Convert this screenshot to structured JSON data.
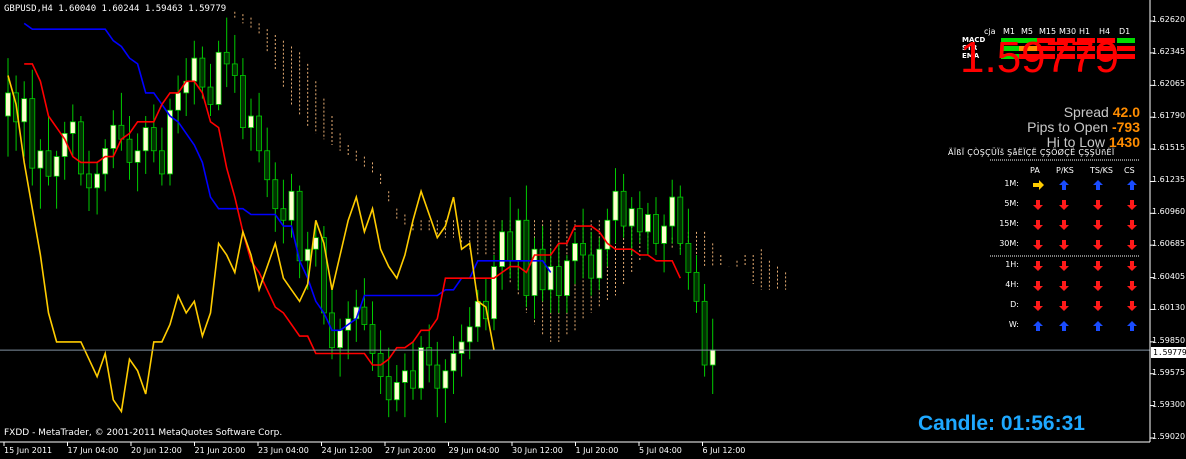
{
  "header": {
    "symbol": "GBPUSD,H4",
    "quote": "1.60040 1.60244 1.59463 1.59779"
  },
  "copyright": "FXDD - MetaTrader, © 2001-2011 MetaQuotes Software Corp.",
  "dashboard": {
    "corner_label": "cja",
    "timeframes": [
      "M1",
      "M5",
      "M15",
      "M30",
      "H1",
      "H4",
      "D1"
    ],
    "indicators": [
      {
        "name": "MACD",
        "colors": [
          "#00dd00",
          "#00dd00",
          "#ff0000",
          "#ff0000",
          "#ff0000",
          "#ff0000",
          "#00dd00"
        ]
      },
      {
        "name": "STR",
        "colors": [
          "#00dd00",
          "#ff8c00",
          "#ff0000",
          "#ff0000",
          "#ff0000",
          "#ff0000",
          "#ff0000"
        ]
      },
      {
        "name": "EMA",
        "colors": [
          "#00dd00",
          "#ff0000",
          "#ff0000",
          "#ff0000",
          "#ff0000",
          "#ff0000",
          "#ff0000"
        ]
      }
    ],
    "price": "1.59779",
    "spread_label": "Spread",
    "spread_value": "42.0",
    "pips_label": "Pips to Open",
    "pips_value": "-793",
    "hilo_label": "Hi to Low",
    "hilo_value": "1430",
    "matrix_title": "ÄÏßÏ ÇÒŞÇÜÏš ŞåËÏÇË ÇŞÖØÇË ÇŞŞÜñËÏ",
    "matrix_columns": [
      "PA",
      "P/KS",
      "TS/KS",
      "CS"
    ],
    "matrix_rows": [
      {
        "label": "1M:",
        "arrows": [
          "right",
          "up",
          "up",
          "up"
        ]
      },
      {
        "label": "5M:",
        "arrows": [
          "down",
          "down",
          "down",
          "down"
        ]
      },
      {
        "label": "15M:",
        "arrows": [
          "down",
          "down",
          "down",
          "down"
        ]
      },
      {
        "label": "30M:",
        "arrows": [
          "down",
          "down",
          "down",
          "down"
        ]
      },
      {
        "label": "1H:",
        "arrows": [
          "down",
          "down",
          "down",
          "down"
        ]
      },
      {
        "label": "4H:",
        "arrows": [
          "down",
          "down",
          "down",
          "down"
        ]
      },
      {
        "label": "D:",
        "arrows": [
          "down",
          "down",
          "down",
          "down"
        ]
      },
      {
        "label": "W:",
        "arrows": [
          "up",
          "up",
          "up",
          "up"
        ]
      }
    ],
    "candle_label": "Candle:",
    "candle_time": "01:56:31"
  },
  "colors": {
    "up_arrow": "#1a4cff",
    "down_arrow": "#ff1a1a",
    "right_arrow": "#ffcc00",
    "tenkan": "#ff0000",
    "kijun": "#0000ff",
    "chikou": "#ffcc00",
    "candle_up": "#ffffd0",
    "candle_down": "#003300",
    "wick": "#00cc00",
    "cloud": "#ffc080"
  },
  "chart_data": {
    "type": "candlestick",
    "symbol": "GBPUSD",
    "timeframe": "H4",
    "current_price": "1.59779",
    "ylim": [
      1.5902,
      1.6275
    ],
    "y_ticks": [
      "1.62620",
      "1.62345",
      "1.62065",
      "1.61790",
      "1.61515",
      "1.61235",
      "1.60960",
      "1.60685",
      "1.60405",
      "1.60130",
      "1.59850",
      "1.59575",
      "1.59300",
      "1.59020"
    ],
    "x_ticks": [
      "15 Jun 2011",
      "17 Jun 04:00",
      "20 Jun 12:00",
      "21 Jun 20:00",
      "23 Jun 04:00",
      "24 Jun 12:00",
      "27 Jun 20:00",
      "29 Jun 04:00",
      "30 Jun 12:00",
      "1 Jul 20:00",
      "5 Jul 04:00",
      "6 Jul 12:00"
    ],
    "candles": [
      [
        1.618,
        1.623,
        1.6145,
        1.62
      ],
      [
        1.62,
        1.6215,
        1.615,
        1.6175
      ],
      [
        1.6175,
        1.621,
        1.6145,
        1.6195
      ],
      [
        1.6195,
        1.622,
        1.612,
        1.6135
      ],
      [
        1.6135,
        1.616,
        1.61,
        1.615
      ],
      [
        1.615,
        1.618,
        1.612,
        1.6128
      ],
      [
        1.6128,
        1.615,
        1.61,
        1.6145
      ],
      [
        1.6145,
        1.6175,
        1.6125,
        1.6165
      ],
      [
        1.6165,
        1.619,
        1.6145,
        1.6175
      ],
      [
        1.6175,
        1.618,
        1.612,
        1.613
      ],
      [
        1.613,
        1.615,
        1.6098,
        1.6118
      ],
      [
        1.6118,
        1.614,
        1.6095,
        1.613
      ],
      [
        1.613,
        1.616,
        1.6115,
        1.6152
      ],
      [
        1.6152,
        1.6185,
        1.6135,
        1.6172
      ],
      [
        1.6172,
        1.62,
        1.615,
        1.616
      ],
      [
        1.616,
        1.618,
        1.6125,
        1.614
      ],
      [
        1.614,
        1.6165,
        1.6115,
        1.615
      ],
      [
        1.615,
        1.618,
        1.613,
        1.617
      ],
      [
        1.617,
        1.619,
        1.614,
        1.615
      ],
      [
        1.615,
        1.617,
        1.612,
        1.613
      ],
      [
        1.613,
        1.6195,
        1.612,
        1.6185
      ],
      [
        1.6185,
        1.6215,
        1.6165,
        1.62
      ],
      [
        1.62,
        1.623,
        1.618,
        1.621
      ],
      [
        1.621,
        1.6245,
        1.619,
        1.623
      ],
      [
        1.623,
        1.624,
        1.6195,
        1.6205
      ],
      [
        1.6205,
        1.6225,
        1.618,
        1.619
      ],
      [
        1.619,
        1.6245,
        1.6185,
        1.6235
      ],
      [
        1.6235,
        1.6265,
        1.6205,
        1.6225
      ],
      [
        1.6225,
        1.625,
        1.62,
        1.6215
      ],
      [
        1.6215,
        1.623,
        1.616,
        1.617
      ],
      [
        1.617,
        1.6195,
        1.615,
        1.618
      ],
      [
        1.618,
        1.62,
        1.614,
        1.615
      ],
      [
        1.615,
        1.617,
        1.611,
        1.6125
      ],
      [
        1.6125,
        1.614,
        1.608,
        1.61
      ],
      [
        1.61,
        1.6125,
        1.607,
        1.609
      ],
      [
        1.609,
        1.613,
        1.6075,
        1.6115
      ],
      [
        1.6115,
        1.612,
        1.604,
        1.6055
      ],
      [
        1.6055,
        1.608,
        1.603,
        1.6065
      ],
      [
        1.6065,
        1.609,
        1.605,
        1.6075
      ],
      [
        1.6075,
        1.6085,
        1.6,
        1.601
      ],
      [
        1.601,
        1.603,
        1.597,
        1.598
      ],
      [
        1.598,
        1.6005,
        1.5955,
        1.5995
      ],
      [
        1.5995,
        1.602,
        1.597,
        1.6005
      ],
      [
        1.6005,
        1.603,
        1.5985,
        1.6015
      ],
      [
        1.6015,
        1.604,
        1.5995,
        1.6
      ],
      [
        1.6,
        1.602,
        1.596,
        1.5975
      ],
      [
        1.5975,
        1.5995,
        1.594,
        1.5955
      ],
      [
        1.5955,
        1.598,
        1.592,
        1.5935
      ],
      [
        1.5935,
        1.5965,
        1.5925,
        1.595
      ],
      [
        1.595,
        1.5975,
        1.592,
        1.596
      ],
      [
        1.596,
        1.5985,
        1.5935,
        1.5945
      ],
      [
        1.5945,
        1.599,
        1.5935,
        1.598
      ],
      [
        1.598,
        1.6,
        1.595,
        1.5965
      ],
      [
        1.5965,
        1.5985,
        1.592,
        1.5945
      ],
      [
        1.5945,
        1.597,
        1.5915,
        1.596
      ],
      [
        1.596,
        1.599,
        1.594,
        1.5975
      ],
      [
        1.5975,
        1.6,
        1.5955,
        1.5985
      ],
      [
        1.5985,
        1.6015,
        1.597,
        1.5998
      ],
      [
        1.5998,
        1.603,
        1.5985,
        1.602
      ],
      [
        1.602,
        1.604,
        1.5995,
        1.6005
      ],
      [
        1.6005,
        1.606,
        1.5995,
        1.605
      ],
      [
        1.605,
        1.609,
        1.603,
        1.608
      ],
      [
        1.608,
        1.611,
        1.604,
        1.6055
      ],
      [
        1.6055,
        1.61,
        1.603,
        1.609
      ],
      [
        1.609,
        1.612,
        1.6015,
        1.6025
      ],
      [
        1.6025,
        1.6075,
        1.6005,
        1.6065
      ],
      [
        1.6065,
        1.6085,
        1.602,
        1.603
      ],
      [
        1.603,
        1.6065,
        1.601,
        1.605
      ],
      [
        1.605,
        1.607,
        1.601,
        1.6025
      ],
      [
        1.6025,
        1.606,
        1.601,
        1.6055
      ],
      [
        1.6055,
        1.608,
        1.6035,
        1.607
      ],
      [
        1.607,
        1.61,
        1.604,
        1.606
      ],
      [
        1.606,
        1.608,
        1.6025,
        1.604
      ],
      [
        1.604,
        1.6075,
        1.603,
        1.6065
      ],
      [
        1.6065,
        1.61,
        1.605,
        1.609
      ],
      [
        1.609,
        1.6135,
        1.607,
        1.6115
      ],
      [
        1.6115,
        1.613,
        1.6075,
        1.6085
      ],
      [
        1.6085,
        1.611,
        1.606,
        1.61
      ],
      [
        1.61,
        1.6115,
        1.607,
        1.608
      ],
      [
        1.608,
        1.6105,
        1.606,
        1.6095
      ],
      [
        1.6095,
        1.611,
        1.606,
        1.607
      ],
      [
        1.607,
        1.6095,
        1.6045,
        1.6085
      ],
      [
        1.6085,
        1.6125,
        1.607,
        1.611
      ],
      [
        1.611,
        1.612,
        1.606,
        1.607
      ],
      [
        1.607,
        1.61,
        1.603,
        1.6045
      ],
      [
        1.6045,
        1.606,
        1.601,
        1.602
      ],
      [
        1.602,
        1.6035,
        1.5955,
        1.5965
      ],
      [
        1.5965,
        1.6005,
        1.594,
        1.5978
      ]
    ],
    "tenkan": [
      1.6225,
      1.6225,
      1.621,
      1.618,
      1.617,
      1.616,
      1.6145,
      1.614,
      1.614,
      1.614,
      1.6145,
      1.6145,
      1.616,
      1.6165,
      1.6175,
      1.6175,
      1.6175,
      1.619,
      1.62,
      1.62,
      1.621,
      1.621,
      1.62,
      1.6175,
      1.617,
      1.6135,
      1.611,
      1.608,
      1.6055,
      1.6045,
      1.603,
      1.6015,
      1.601,
      1.6,
      1.599,
      1.599,
      1.5975,
      1.5975,
      1.5975,
      1.5975,
      1.5975,
      1.5975,
      1.5975,
      1.5965,
      1.5965,
      1.597,
      1.598,
      1.598,
      1.5985,
      1.5995,
      1.5995,
      1.6005,
      1.604,
      1.604,
      1.604,
      1.604,
      1.604,
      1.604,
      1.604,
      1.6045,
      1.605,
      1.605,
      1.6045,
      1.606,
      1.606,
      1.606,
      1.607,
      1.607,
      1.6085,
      1.6085,
      1.6085,
      1.608,
      1.607,
      1.6065,
      1.6065,
      1.6065,
      1.606,
      1.606,
      1.6055,
      1.6055,
      1.6055,
      1.604
    ],
    "kijun": [
      1.626,
      1.6255,
      1.6255,
      1.6255,
      1.6255,
      1.6255,
      1.6255,
      1.6255,
      1.6255,
      1.6255,
      1.6255,
      1.6245,
      1.624,
      1.623,
      1.6225,
      1.62,
      1.62,
      1.619,
      1.618,
      1.6175,
      1.6165,
      1.6155,
      1.614,
      1.611,
      1.61,
      1.61,
      1.61,
      1.61,
      1.6095,
      1.6095,
      1.6095,
      1.6095,
      1.6085,
      1.6085,
      1.6055,
      1.604,
      1.602,
      1.601,
      1.5995,
      1.5995,
      1.6,
      1.6005,
      1.6025,
      1.6025,
      1.6025,
      1.6025,
      1.6025,
      1.6025,
      1.6025,
      1.6025,
      1.6025,
      1.6025,
      1.603,
      1.603,
      1.604,
      1.604,
      1.6055,
      1.6055,
      1.6055,
      1.6055,
      1.6055,
      1.6055,
      1.6055,
      1.6055,
      1.6055,
      1.6045
    ],
    "chikou": [
      1.6215,
      1.619,
      1.614,
      1.61,
      1.606,
      1.601,
      1.5985,
      1.5985,
      1.5985,
      1.5985,
      1.597,
      1.5955,
      1.5975,
      1.5935,
      1.5925,
      1.597,
      1.596,
      1.594,
      1.5985,
      1.5985,
      1.6,
      1.6025,
      1.601,
      1.602,
      1.599,
      1.601,
      1.607,
      1.606,
      1.6045,
      1.608,
      1.606,
      1.603,
      1.605,
      1.607,
      1.604,
      1.603,
      1.602,
      1.6035,
      1.609,
      1.607,
      1.603,
      1.606,
      1.609,
      1.611,
      1.608,
      1.61,
      1.6065,
      1.605,
      1.604,
      1.606,
      1.609,
      1.6115,
      1.6095,
      1.6075,
      1.6085,
      1.611,
      1.6065,
      1.607,
      1.602,
      1.6015,
      1.5978
    ],
    "cloud_a": [
      1.6265,
      1.626,
      1.6255,
      1.625,
      1.6235,
      1.622,
      1.6205,
      1.619,
      1.618,
      1.617,
      1.6165,
      1.616,
      1.6155,
      1.615,
      1.6145,
      1.614,
      1.6135,
      1.613,
      1.612,
      1.6105,
      1.609,
      1.6085,
      1.608,
      1.608,
      1.608,
      1.6075,
      1.6075,
      1.6075,
      1.607,
      1.6065,
      1.606,
      1.606,
      1.6055,
      1.605,
      1.6035,
      1.6025,
      1.601,
      1.6,
      1.599,
      1.5985,
      1.5985,
      1.599,
      1.5995,
      1.6005,
      1.601,
      1.6015,
      1.602,
      1.6025,
      1.6035,
      1.6045,
      1.6055,
      1.6065,
      1.607,
      1.6075,
      1.6075,
      1.608,
      1.608,
      1.608,
      1.608,
      1.607,
      1.606,
      1.605,
      1.6055,
      1.606,
      1.606,
      1.6065,
      1.6055,
      1.605,
      1.6045
    ],
    "cloud_b": [
      1.627,
      1.6268,
      1.6265,
      1.626,
      1.6255,
      1.625,
      1.6245,
      1.624,
      1.6235,
      1.6225,
      1.621,
      1.6195,
      1.618,
      1.6165,
      1.6155,
      1.615,
      1.6145,
      1.614,
      1.613,
      1.6115,
      1.61,
      1.6095,
      1.609,
      1.609,
      1.609,
      1.609,
      1.609,
      1.609,
      1.609,
      1.609,
      1.609,
      1.609,
      1.609,
      1.609,
      1.609,
      1.609,
      1.609,
      1.609,
      1.609,
      1.609,
      1.609,
      1.609,
      1.609,
      1.609,
      1.609,
      1.609,
      1.6085,
      1.6085,
      1.6085,
      1.6085,
      1.6085,
      1.608,
      1.6075,
      1.6075,
      1.6065,
      1.6065,
      1.606,
      1.6055,
      1.605,
      1.605,
      1.605,
      1.605,
      1.605,
      1.605,
      1.6035,
      1.603,
      1.603,
      1.603,
      1.603
    ]
  }
}
